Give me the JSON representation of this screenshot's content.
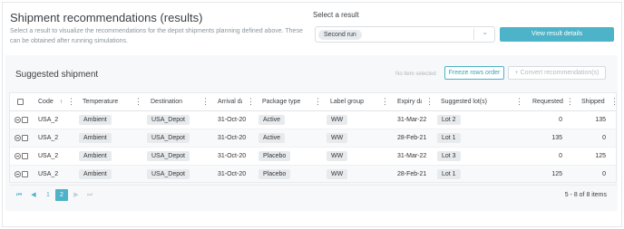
{
  "header": {
    "title": "Shipment recommendations (results)",
    "description": "Select a result to visualize the recommendations for the depot shipments planning defined above. These can be obtained after running simulations."
  },
  "result_select": {
    "label": "Select a result",
    "selected": "Second run"
  },
  "buttons": {
    "view_details": "View result details",
    "create_rows": "Freeze rows order",
    "convert": "+ Convert recommendation(s)"
  },
  "suggested": {
    "title": "Suggested shipment",
    "selection_status": "No item selected"
  },
  "table": {
    "columns": {
      "code": "Code",
      "temperature": "Temperature",
      "destination": "Destination",
      "arrival": "Arrival da",
      "package_type": "Package type",
      "label_group": "Label group",
      "expiry": "Expiry da",
      "suggested_lots": "Suggested lot(s)",
      "requested": "Requested",
      "shipped": "Shipped"
    },
    "rows": [
      {
        "code": "USA_2",
        "temperature": "Ambient",
        "destination": "USA_Depot",
        "arrival": "31-Oct-20",
        "package_type": "Active",
        "label_group": "WW",
        "expiry": "31-Mar-22",
        "suggested_lots": "Lot 2",
        "requested": "0",
        "shipped": "135"
      },
      {
        "code": "USA_2",
        "temperature": "Ambient",
        "destination": "USA_Depot",
        "arrival": "31-Oct-20",
        "package_type": "Active",
        "label_group": "WW",
        "expiry": "28-Feb-21",
        "suggested_lots": "Lot 1",
        "requested": "135",
        "shipped": "0"
      },
      {
        "code": "USA_2",
        "temperature": "Ambient",
        "destination": "USA_Depot",
        "arrival": "31-Oct-20",
        "package_type": "Placebo",
        "label_group": "WW",
        "expiry": "31-Mar-22",
        "suggested_lots": "Lot 3",
        "requested": "0",
        "shipped": "125"
      },
      {
        "code": "USA_2",
        "temperature": "Ambient",
        "destination": "USA_Depot",
        "arrival": "31-Oct-20",
        "package_type": "Placebo",
        "label_group": "WW",
        "expiry": "28-Feb-21",
        "suggested_lots": "Lot 1",
        "requested": "125",
        "shipped": "0"
      }
    ]
  },
  "pager": {
    "first": "⏮",
    "prev": "◀",
    "pages": [
      "1",
      "2"
    ],
    "next": "▶",
    "last": "⏭",
    "summary": "5 - 8 of 8 items"
  },
  "colors": {
    "accent": "#4db3c8"
  }
}
